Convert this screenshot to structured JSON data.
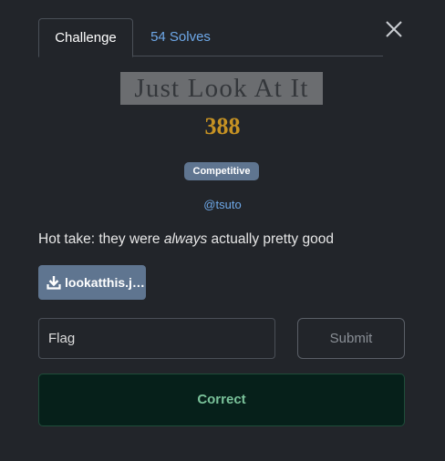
{
  "tabs": {
    "challenge_label": "Challenge",
    "solves_label": "54 Solves"
  },
  "challenge": {
    "title": "Just Look At It",
    "points": "388",
    "category_badge": "Competitive",
    "author": "@tsuto",
    "description_before": "Hot take: they were ",
    "description_emphasis": "always",
    "description_after": " actually pretty good",
    "file_label": "lookatthis.j…"
  },
  "flag_form": {
    "placeholder": "Flag",
    "submit_label": "Submit"
  },
  "result": {
    "message": "Correct"
  },
  "icons": {
    "close": "close-icon",
    "download": "download-icon"
  },
  "colors": {
    "background": "#22252a",
    "link": "#6ea8e8",
    "points": "#c69223",
    "badge": "#5f7590",
    "success_bg": "#06201a",
    "success_text": "#7ac29a"
  }
}
